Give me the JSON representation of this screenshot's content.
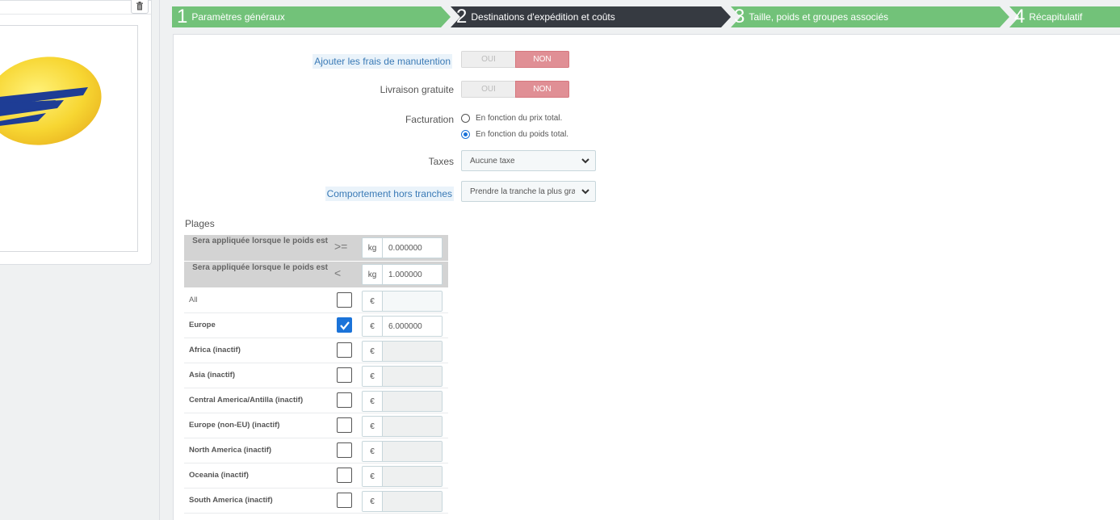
{
  "steps": [
    {
      "num": "1",
      "label": "Paramètres généraux",
      "active": false
    },
    {
      "num": "2",
      "label": "Destinations d'expédition et coûts",
      "active": true
    },
    {
      "num": "3",
      "label": "Taille, poids et groupes associés",
      "active": false
    },
    {
      "num": "4",
      "label": "Récapitulatif",
      "active": false
    }
  ],
  "colors": {
    "step_done": "#72c279",
    "step_active": "#363a41",
    "switch_on": "#e08f95",
    "accent": "#1b73d9"
  },
  "form": {
    "handling": {
      "label": "Ajouter les frais de manutention",
      "off": "OUI",
      "on": "NON"
    },
    "free_shipping": {
      "label": "Livraison gratuite",
      "off": "OUI",
      "on": "NON"
    },
    "billing": {
      "label": "Facturation",
      "option1": "En fonction du prix total.",
      "option2": "En fonction du poids total.",
      "selected": 2
    },
    "taxes": {
      "label": "Taxes",
      "value": "Aucune taxe"
    },
    "out_of_range": {
      "label": "Comportement hors tranches",
      "value": "Prendre la tranche la plus grande"
    }
  },
  "plages": {
    "title": "Plages",
    "range_from": {
      "label": "Sera appliquée lorsque le poids est",
      "op": ">=",
      "unit": "kg",
      "value": "0.000000"
    },
    "range_to": {
      "label": "Sera appliquée lorsque le poids est",
      "op": "<",
      "unit": "kg",
      "value": "1.000000"
    },
    "currency": "€",
    "zones": [
      {
        "name": "All",
        "checked": false,
        "value": "",
        "inactive": false
      },
      {
        "name": "Europe",
        "checked": true,
        "value": "6.000000",
        "inactive": false
      },
      {
        "name": "Africa (inactif)",
        "checked": false,
        "value": "",
        "inactive": true
      },
      {
        "name": "Asia (inactif)",
        "checked": false,
        "value": "",
        "inactive": true
      },
      {
        "name": "Central America/Antilla (inactif)",
        "checked": false,
        "value": "",
        "inactive": true
      },
      {
        "name": "Europe (non-EU) (inactif)",
        "checked": false,
        "value": "",
        "inactive": true
      },
      {
        "name": "North America (inactif)",
        "checked": false,
        "value": "",
        "inactive": true
      },
      {
        "name": "Oceania (inactif)",
        "checked": false,
        "value": "",
        "inactive": true
      },
      {
        "name": "South America (inactif)",
        "checked": false,
        "value": "",
        "inactive": true
      }
    ]
  }
}
